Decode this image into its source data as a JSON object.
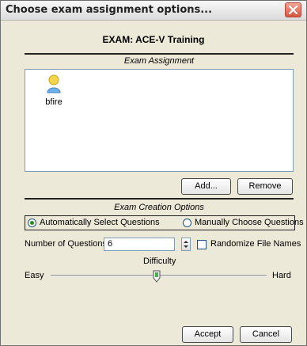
{
  "window": {
    "title": "Choose exam assignment options..."
  },
  "exam": {
    "title": "EXAM: ACE-V Training"
  },
  "assignment": {
    "section_label": "Exam Assignment",
    "users": [
      {
        "name": "bfire",
        "icon": "user-icon"
      }
    ],
    "add_label": "Add...",
    "remove_label": "Remove"
  },
  "creation": {
    "section_label": "Exam Creation Options",
    "auto_select_label": "Automatically Select Questions",
    "manual_label": "Manually Choose Questions",
    "selected_mode": "auto",
    "num_questions_label": "Number of Questions:",
    "num_questions_value": "6",
    "randomize_label": "Randomize File Names",
    "randomize_checked": false,
    "difficulty_label": "Difficulty",
    "difficulty_min_label": "Easy",
    "difficulty_max_label": "Hard",
    "difficulty_level": 0.5
  },
  "footer": {
    "accept_label": "Accept",
    "cancel_label": "Cancel"
  },
  "colors": {
    "close_button": "#d8553f",
    "radio_selected": "#2a8a2a",
    "input_border": "#7f9db9"
  }
}
